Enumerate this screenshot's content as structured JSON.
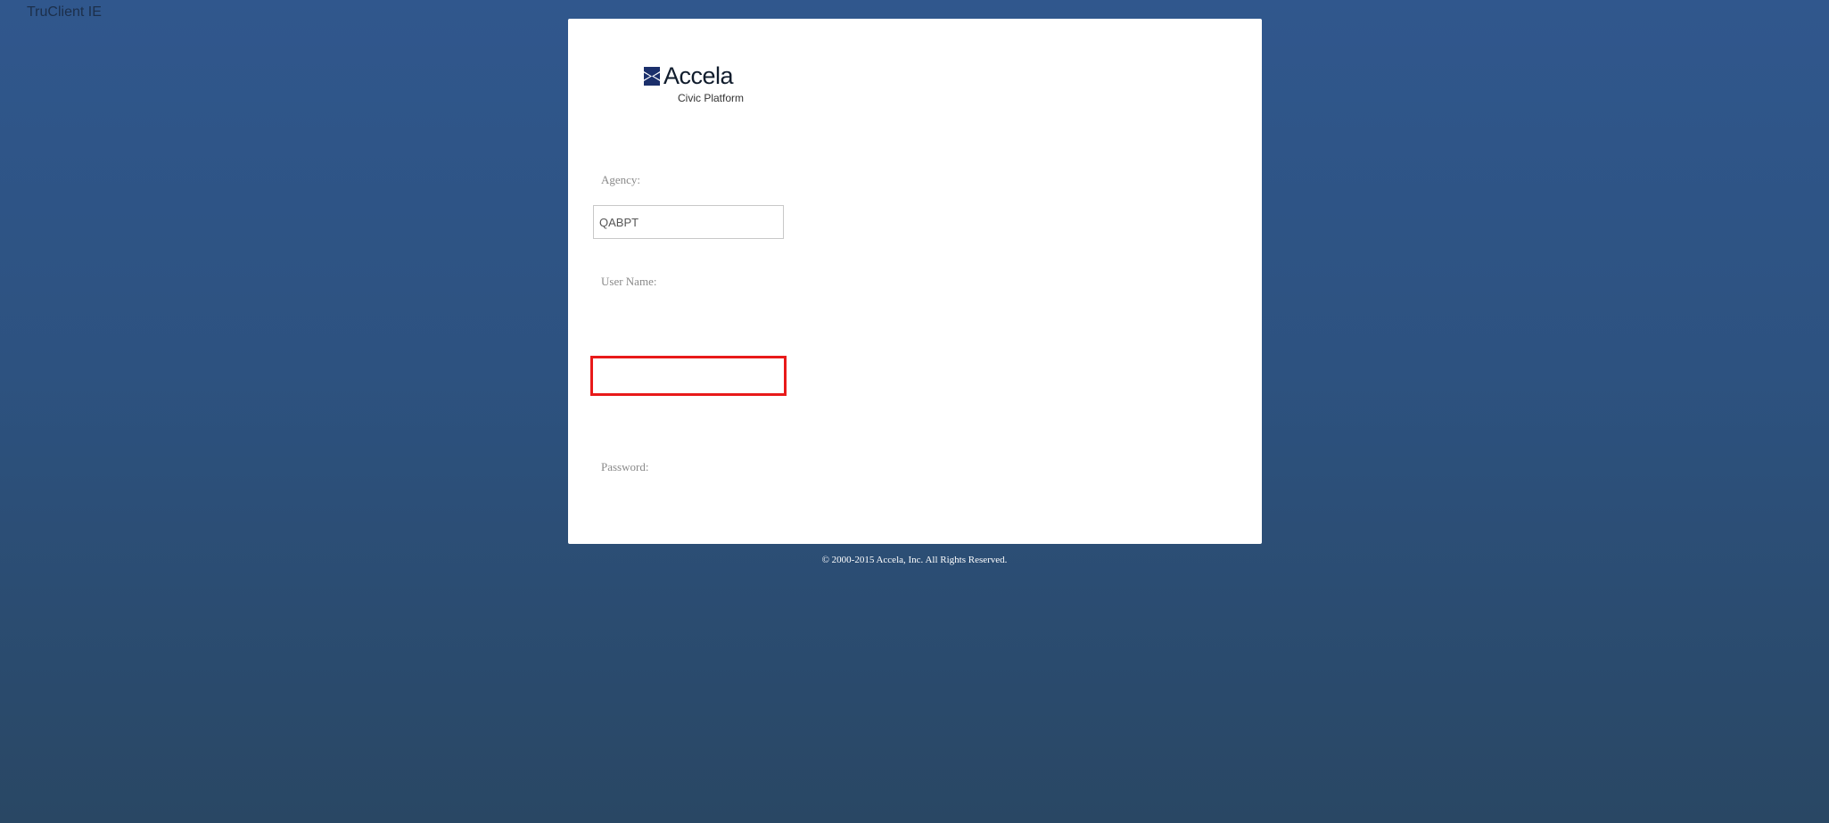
{
  "window": {
    "title": "TruClient IE"
  },
  "logo": {
    "name": "Accela",
    "tagline": "Civic Platform",
    "brand_color": "#1b2f6b"
  },
  "login": {
    "agency_label": "Agency:",
    "agency_value": "QABPT",
    "username_label": "User Name:",
    "username_value": "",
    "password_label": "Password:"
  },
  "highlight_color": "#e81a1a",
  "footer": {
    "copyright": "© 2000-2015 Accela, Inc. All Rights Reserved."
  }
}
